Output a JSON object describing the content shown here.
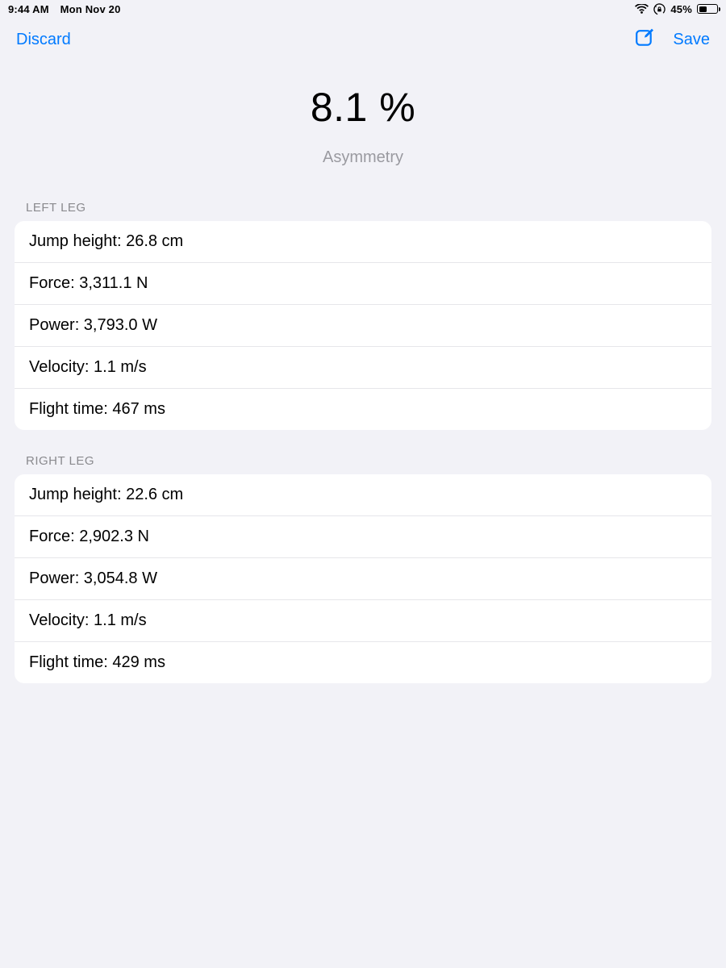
{
  "status": {
    "time": "9:44 AM",
    "date": "Mon Nov 20",
    "battery_pct": "45%",
    "battery_fill": 45,
    "icons": {
      "wifi": "wifi-icon",
      "lock": "orientation-lock-icon",
      "battery": "battery-icon"
    }
  },
  "nav": {
    "discard_label": "Discard",
    "compose_label": "Compose",
    "save_label": "Save"
  },
  "headline": {
    "value": "8.1 %",
    "label": "Asymmetry"
  },
  "sections": {
    "left": {
      "header": "LEFT LEG",
      "rows": [
        "Jump height: 26.8 cm",
        "Force: 3,311.1 N",
        "Power: 3,793.0 W",
        "Velocity: 1.1 m/s",
        "Flight time: 467 ms"
      ]
    },
    "right": {
      "header": "RIGHT LEG",
      "rows": [
        "Jump height: 22.6 cm",
        "Force: 2,902.3 N",
        "Power: 3,054.8 W",
        "Velocity: 1.1 m/s",
        "Flight time: 429 ms"
      ]
    }
  },
  "colors": {
    "accent": "#007aff",
    "bg": "#f2f2f7"
  }
}
